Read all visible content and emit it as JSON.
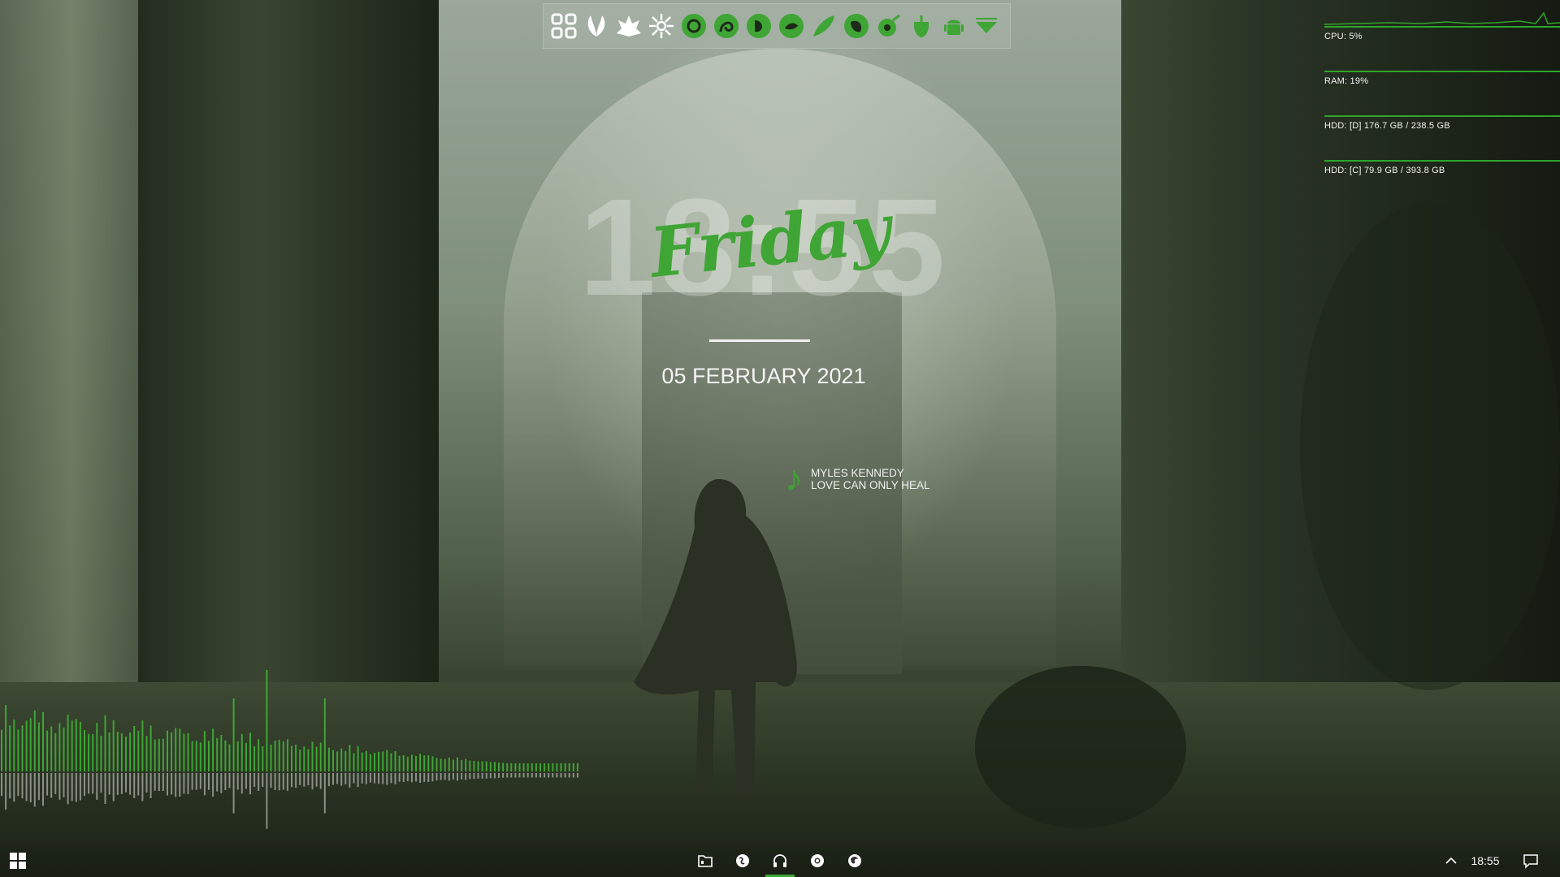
{
  "clock": {
    "time": "18:55",
    "day": "Friday",
    "date": "05 FEBRUARY 2021"
  },
  "music": {
    "artist": "MYLES KENNEDY",
    "title": "LOVE CAN ONLY HEAL"
  },
  "system": {
    "cpu_label": "CPU: 5%",
    "ram_label": "RAM: 19%",
    "hdd_d_label": "HDD: [D] 176.7 GB / 238.5 GB",
    "hdd_c_label": "HDD: [C] 79.9 GB / 393.8 GB",
    "cpu_percent": 5,
    "ram_percent": 19,
    "hdd_d_used_fraction": 0.741,
    "hdd_c_used_fraction": 0.203
  },
  "dock": {
    "icons": [
      "grid-launcher-icon",
      "leaf-icon",
      "lotus-icon",
      "flower-icon",
      "circle-leaf-icon",
      "swirl-leaf-icon",
      "leaf-drop-icon",
      "sprout-icon",
      "fern-icon",
      "leaf-cup-icon",
      "seed-icon",
      "acorn-icon",
      "android-icon",
      "down-arrow-icon"
    ]
  },
  "taskbar": {
    "apps": [
      "file-explorer-icon",
      "browser-globe-icon",
      "music-headphones-icon",
      "chrome-icon",
      "firefox-icon"
    ],
    "active_app": "music-headphones-icon",
    "clock": "18:55"
  },
  "colors": {
    "accent": "#3fa535"
  }
}
